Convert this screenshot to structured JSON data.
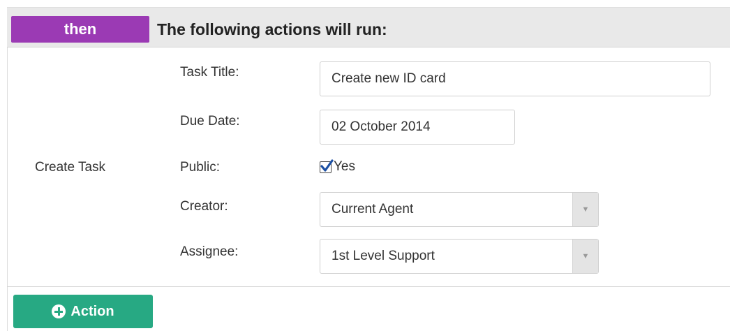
{
  "section": {
    "badge": "then",
    "title": "The following actions will run:"
  },
  "action": {
    "type_label": "Create Task",
    "fields": {
      "task_title": {
        "label": "Task Title:",
        "value": "Create new ID card"
      },
      "due_date": {
        "label": "Due Date:",
        "value": "02 October 2014"
      },
      "public": {
        "label": "Public:",
        "checked": true,
        "option_label": "Yes"
      },
      "creator": {
        "label": "Creator:",
        "selected": "Current Agent"
      },
      "assignee": {
        "label": "Assignee:",
        "selected": "1st Level Support"
      }
    }
  },
  "footer": {
    "add_action_label": "Action"
  },
  "colors": {
    "badge": "#9b3ab4",
    "header_bg": "#e9e9e9",
    "action_button": "#27a983"
  },
  "icons": {
    "add": "plus-circle-icon",
    "dropdown": "chevron-down-icon",
    "check": "checkmark-icon"
  }
}
